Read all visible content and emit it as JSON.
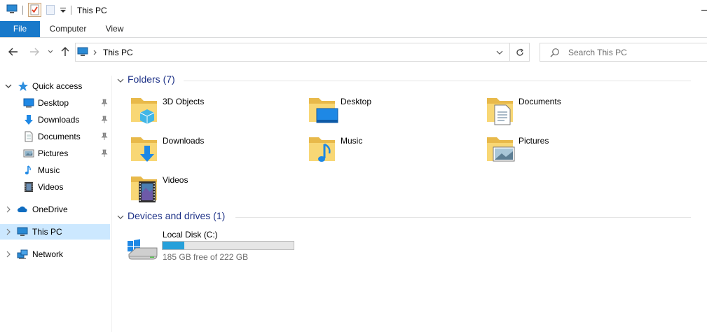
{
  "window": {
    "title": "This PC"
  },
  "ribbon": {
    "tabs": [
      "File",
      "Computer",
      "View"
    ]
  },
  "address_bar": {
    "path": "This PC"
  },
  "search": {
    "placeholder": "Search This PC"
  },
  "colors": {
    "accent": "#1979ca",
    "selection": "#cce8ff",
    "group_title": "#1e3287",
    "drive_bar": "#26a0da",
    "folder": "#f8d775"
  },
  "nav": {
    "quick_access": {
      "label": "Quick access",
      "icon": "star-icon"
    },
    "pinned": [
      {
        "label": "Desktop",
        "icon": "desktop-icon",
        "pinned": true
      },
      {
        "label": "Downloads",
        "icon": "download-arrow-icon",
        "pinned": true
      },
      {
        "label": "Documents",
        "icon": "document-icon",
        "pinned": true
      },
      {
        "label": "Pictures",
        "icon": "picture-icon",
        "pinned": true
      },
      {
        "label": "Music",
        "icon": "music-note-icon",
        "pinned": false
      },
      {
        "label": "Videos",
        "icon": "film-icon",
        "pinned": false
      }
    ],
    "roots": [
      {
        "label": "OneDrive",
        "icon": "cloud-icon"
      },
      {
        "label": "This PC",
        "icon": "computer-icon",
        "selected": true
      },
      {
        "label": "Network",
        "icon": "network-icon"
      }
    ]
  },
  "content": {
    "folders_header": "Folders (7)",
    "folders": [
      {
        "name": "3D Objects",
        "overlay": "cube-icon"
      },
      {
        "name": "Desktop",
        "overlay": "desktop-icon"
      },
      {
        "name": "Documents",
        "overlay": "document-icon"
      },
      {
        "name": "Downloads",
        "overlay": "download-arrow-icon"
      },
      {
        "name": "Music",
        "overlay": "music-note-icon"
      },
      {
        "name": "Pictures",
        "overlay": "picture-icon"
      },
      {
        "name": "Videos",
        "overlay": "film-icon"
      }
    ],
    "drives_header": "Devices and drives (1)",
    "drives": [
      {
        "name": "Local Disk (C:)",
        "free_text": "185 GB free of 222 GB",
        "used_fraction": 0.167
      }
    ]
  }
}
